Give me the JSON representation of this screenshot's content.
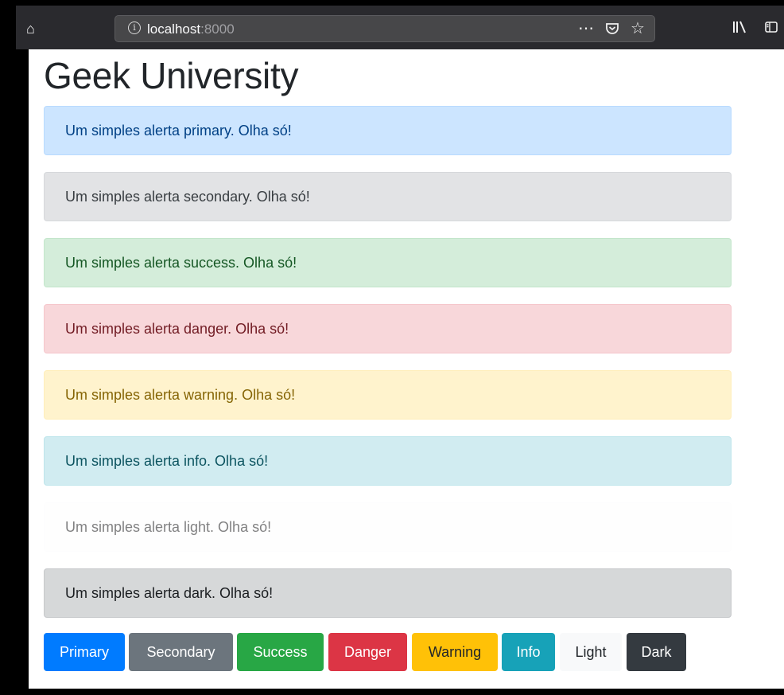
{
  "browser": {
    "url_host": "localhost",
    "url_port": ":8000",
    "icons": [
      "home-icon",
      "info-icon",
      "more-icon",
      "pocket-icon",
      "bookmark-star-icon",
      "library-icon",
      "sidebar-icon"
    ]
  },
  "page": {
    "heading": "Geek University",
    "alerts": [
      {
        "variant": "primary",
        "text": "Um simples alerta primary. Olha só!",
        "bg": "#cce5ff",
        "border": "#b8daff",
        "color": "#004085"
      },
      {
        "variant": "secondary",
        "text": "Um simples alerta secondary. Olha só!",
        "bg": "#e2e3e5",
        "border": "#d6d8db",
        "color": "#383d41"
      },
      {
        "variant": "success",
        "text": "Um simples alerta success. Olha só!",
        "bg": "#d4edda",
        "border": "#c3e6cb",
        "color": "#155724"
      },
      {
        "variant": "danger",
        "text": "Um simples alerta danger. Olha só!",
        "bg": "#f8d7da",
        "border": "#f5c6cb",
        "color": "#721c24"
      },
      {
        "variant": "warning",
        "text": "Um simples alerta warning. Olha só!",
        "bg": "#fff3cd",
        "border": "#ffeeba",
        "color": "#856404"
      },
      {
        "variant": "info",
        "text": "Um simples alerta info. Olha só!",
        "bg": "#d1ecf1",
        "border": "#bee5eb",
        "color": "#0c5460"
      },
      {
        "variant": "light",
        "text": "Um simples alerta light. Olha só!",
        "bg": "#fefefe",
        "border": "#fdfdfe",
        "color": "#818182"
      },
      {
        "variant": "dark",
        "text": "Um simples alerta dark. Olha só!",
        "bg": "#d6d8d9",
        "border": "#c6c8ca",
        "color": "#1b1e21"
      }
    ],
    "buttons": [
      {
        "label": "Primary",
        "bg": "#007bff",
        "color": "#ffffff"
      },
      {
        "label": "Secondary",
        "bg": "#6c757d",
        "color": "#ffffff"
      },
      {
        "label": "Success",
        "bg": "#28a745",
        "color": "#ffffff"
      },
      {
        "label": "Danger",
        "bg": "#dc3545",
        "color": "#ffffff"
      },
      {
        "label": "Warning",
        "bg": "#ffc107",
        "color": "#212529"
      },
      {
        "label": "Info",
        "bg": "#17a2b8",
        "color": "#ffffff"
      },
      {
        "label": "Light",
        "bg": "#f8f9fa",
        "color": "#212529"
      },
      {
        "label": "Dark",
        "bg": "#343a40",
        "color": "#ffffff"
      }
    ]
  }
}
